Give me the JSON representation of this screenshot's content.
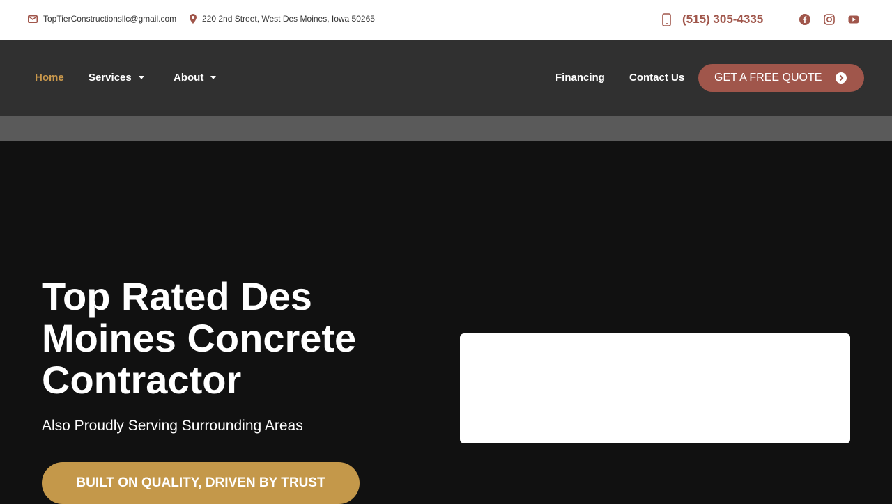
{
  "topbar": {
    "email": "TopTierConstructionsllc@gmail.com",
    "address": "220 2nd Street, West Des Moines, Iowa 50265",
    "phone": "(515) 305-4335",
    "icons": [
      "envelope-icon",
      "map-pin-icon",
      "mobile-phone-icon",
      "facebook-icon",
      "instagram-icon",
      "youtube-icon"
    ]
  },
  "nav": {
    "home": "Home",
    "services": "Services",
    "about": "About",
    "financing": "Financing",
    "contact": "Contact Us",
    "quote_button": "GET A FREE QUOTE"
  },
  "hero": {
    "title": "Top Rated Des Moines Concrete Contractor",
    "subtitle": "Also Proudly Serving Surrounding Areas",
    "button": "BUILT ON QUALITY, DRIVEN BY TRUST"
  },
  "colors": {
    "accent_red": "#a0564b",
    "accent_gold": "#c4984a",
    "nav_active": "#c9984c",
    "nav_bg": "#303030",
    "hero_bg": "#111111"
  }
}
